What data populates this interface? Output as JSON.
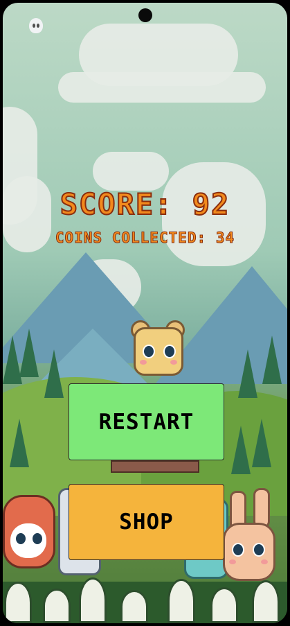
{
  "hud": {
    "score_label": "SCORE:",
    "score_value": "92",
    "coins_label": "COINS COLLECTED:",
    "coins_value": "34"
  },
  "buttons": {
    "restart": "RESTART",
    "shop": "SHOP"
  },
  "colors": {
    "hud_text": "#f28a1d",
    "hud_outline": "#8a2e0e",
    "restart_button": "#7de878",
    "shop_button": "#f5b43c"
  },
  "icons": [
    "camera-icon",
    "ghost-icon"
  ]
}
